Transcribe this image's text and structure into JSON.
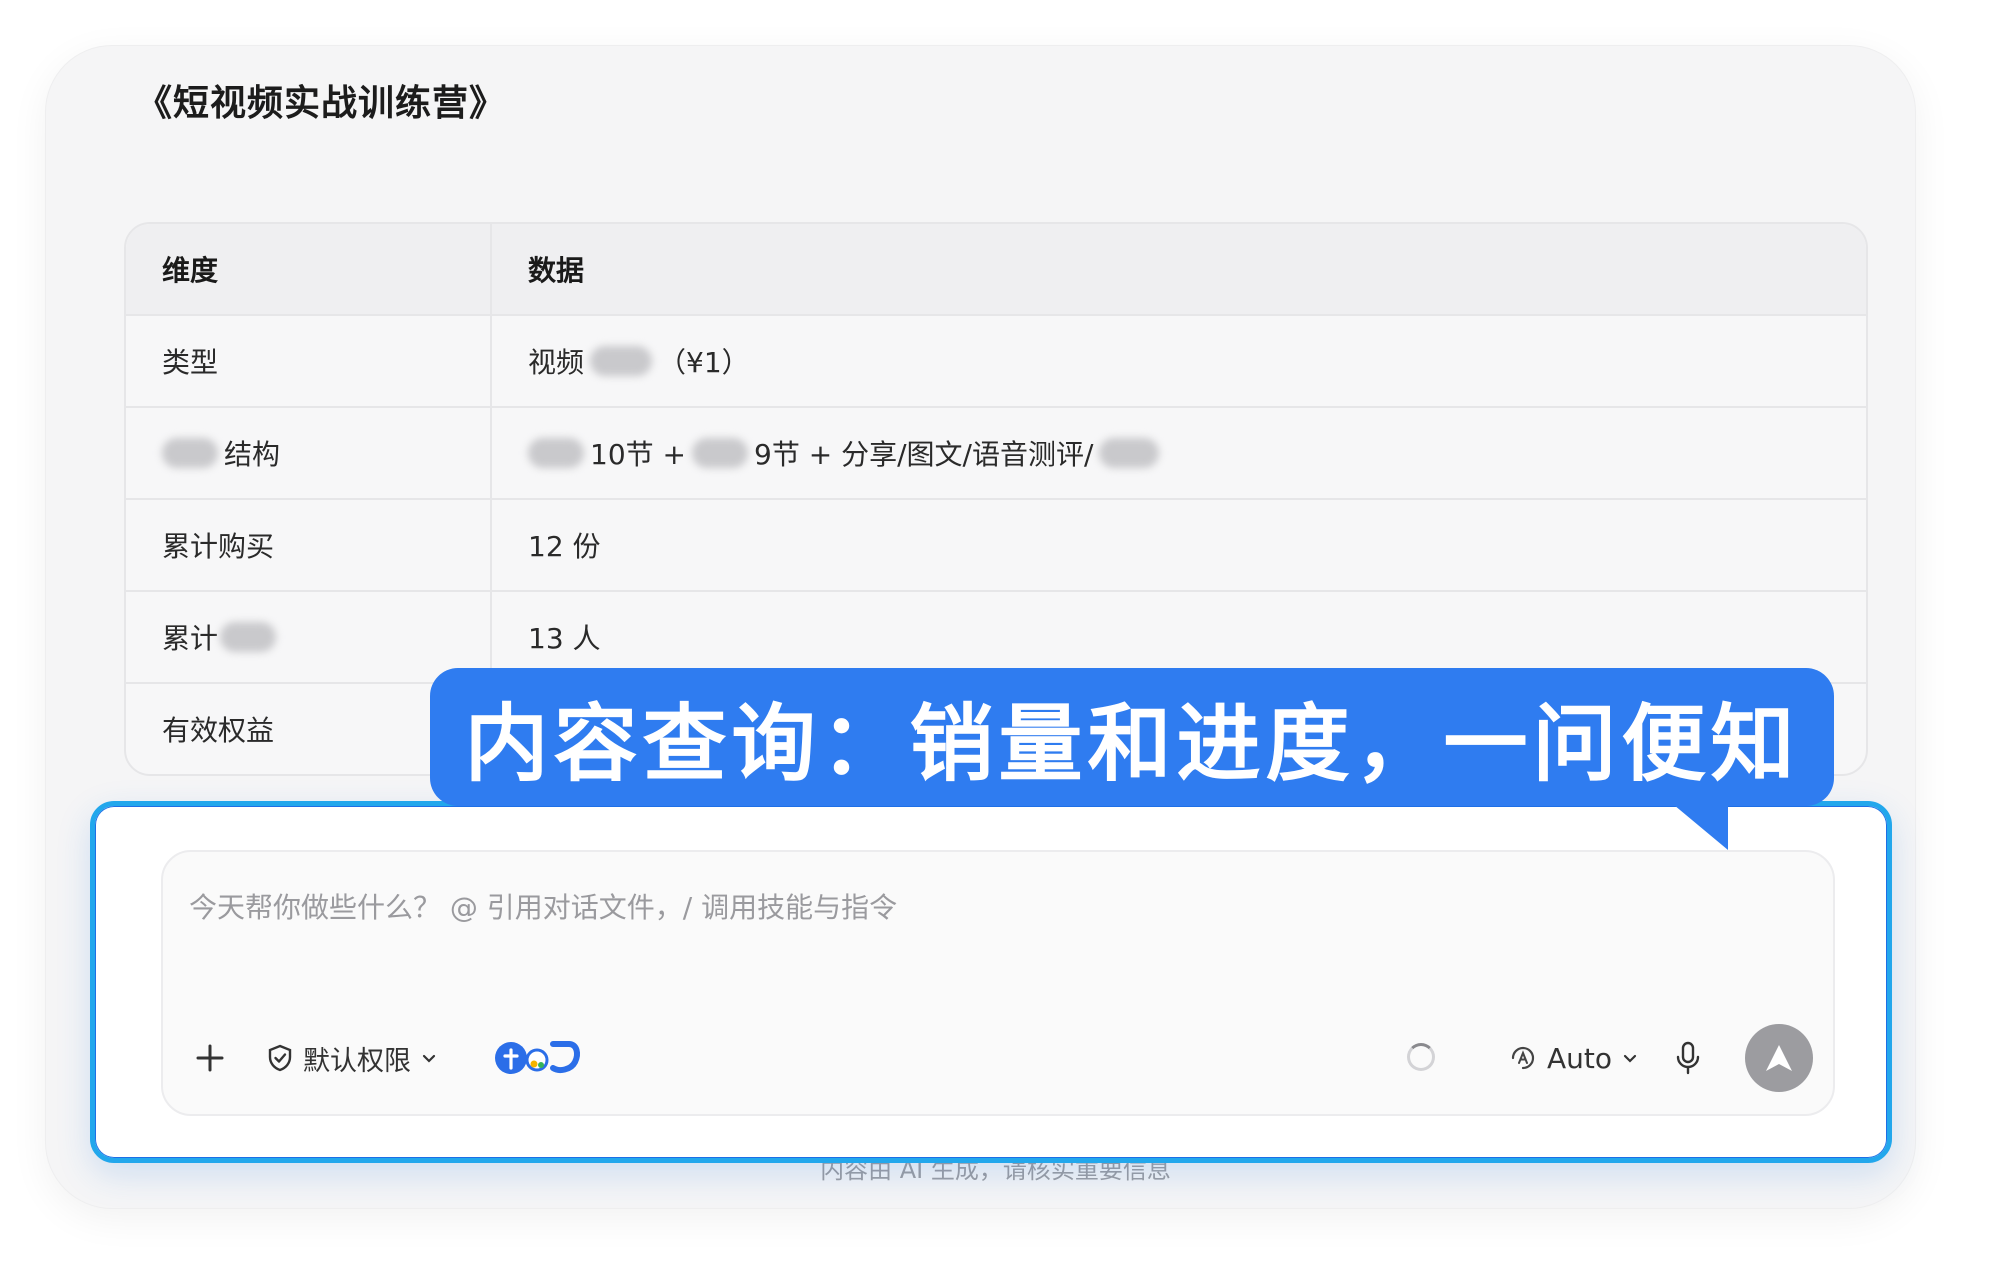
{
  "document": {
    "title": "《短视频实战训练营》"
  },
  "table": {
    "headers": [
      "维度",
      "数据"
    ],
    "rows": [
      {
        "dimension": "类型",
        "data_prefix": "视频",
        "data_suffix": "（¥1）"
      },
      {
        "dimension_suffix": "结构",
        "data_parts": [
          "10节 +",
          "9节 + 分享/图文/语音测评/"
        ]
      },
      {
        "dimension": "累计购买",
        "data": "12 份"
      },
      {
        "dimension_prefix": "累计",
        "data": "13 人"
      },
      {
        "dimension": "有效权益",
        "data": ""
      }
    ]
  },
  "callout": {
    "text": "内容查询：销量和进度，一问便知"
  },
  "input": {
    "placeholder": "今天帮你做些什么？ @ 引用对话文件，/ 调用技能与指令",
    "permission_label": "默认权限",
    "model_label": "Auto"
  },
  "footer": {
    "note": "内容由 AI 生成，请核实重要信息"
  },
  "colors": {
    "accent": "#2f7cf0",
    "frame": "#22a7ec",
    "send": "#9c9ca0"
  },
  "icons": [
    "plus-icon",
    "shield-check-icon",
    "chevron-down-icon",
    "plugin-logos-icon",
    "loading-spinner-icon",
    "auto-model-icon",
    "microphone-icon",
    "send-arrow-icon"
  ]
}
